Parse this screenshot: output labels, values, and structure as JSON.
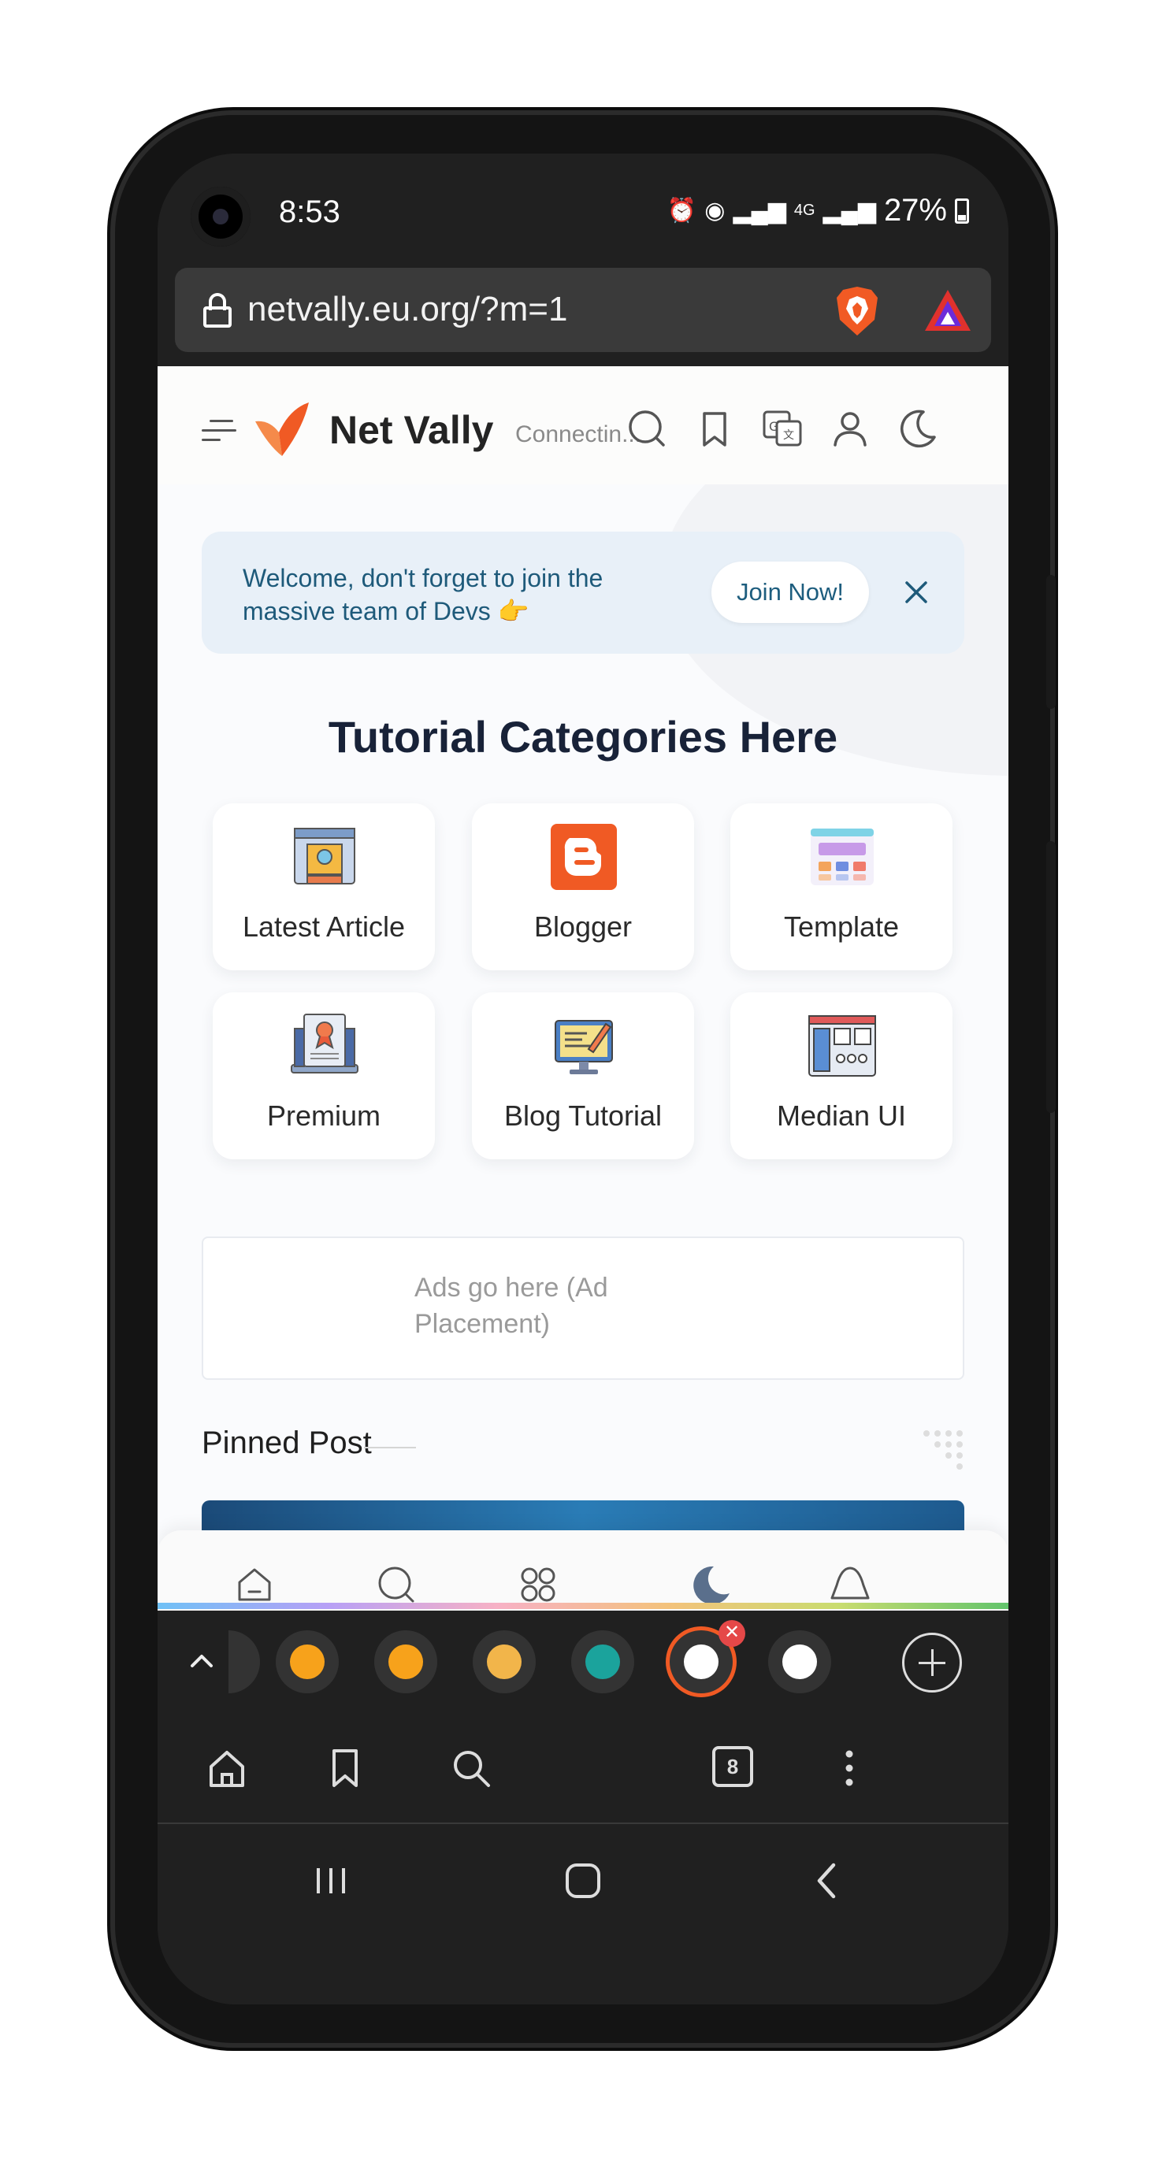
{
  "status_bar": {
    "time": "8:53",
    "network": "4G",
    "battery": "27%"
  },
  "browser": {
    "url": "netvally.eu.org/?m=1",
    "tab_count": "8"
  },
  "site": {
    "brand": "Net Vally",
    "tagline": "Connectin...",
    "banner_text": "Welcome, don't forget to join the massive team of Devs 👉",
    "join_label": "Join Now!",
    "section_title": "Tutorial Categories Here",
    "categories": [
      {
        "label": "Latest Article",
        "icon": "article-icon"
      },
      {
        "label": "Blogger",
        "icon": "blogger-icon"
      },
      {
        "label": "Template",
        "icon": "template-icon"
      },
      {
        "label": "Premium",
        "icon": "premium-icon"
      },
      {
        "label": "Blog Tutorial",
        "icon": "blog-tutorial-icon"
      },
      {
        "label": "Median UI",
        "icon": "median-ui-icon"
      }
    ],
    "ads_text": "Ads go here (Ad Placement)",
    "pinned_title": "Pinned Post"
  },
  "colors": {
    "accent": "#f26a2e",
    "banner_bg": "#e8f0f8",
    "banner_text": "#1e5a7a",
    "title": "#182238"
  }
}
